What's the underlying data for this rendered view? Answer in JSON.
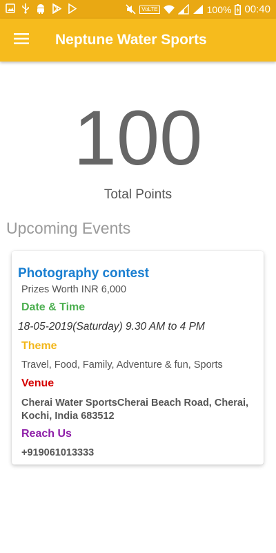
{
  "status_bar": {
    "battery_percent": "100%",
    "time": "00:40",
    "volte_label": "VoLTE",
    "icons_left": [
      "image-icon",
      "usb-icon",
      "android-icon",
      "play-store-icon",
      "play-icon"
    ],
    "icons_right": [
      "mute-icon",
      "volte-icon",
      "wifi-icon",
      "signal-icon",
      "signal-icon",
      "battery-icon"
    ]
  },
  "app_bar": {
    "title": "Neptune Water Sports",
    "menu_icon": "hamburger-menu-icon",
    "background": "#f6bb1d"
  },
  "points": {
    "value": "100",
    "label": "Total Points"
  },
  "upcoming": {
    "title": "Upcoming Events"
  },
  "event": {
    "title": "Photography contest",
    "prize": "Prizes Worth INR 6,000",
    "date_heading": "Date & Time",
    "date_value": "18-05-2019(Saturday) 9.30 AM to 4 PM",
    "theme_heading": "Theme",
    "theme_value": "Travel, Food, Family, Adventure & fun, Sports",
    "venue_heading": "Venue",
    "venue_value": "Cherai Water SportsCherai Beach Road, Cherai, Kochi, India 683512",
    "reach_heading": "Reach Us",
    "phone": "+919061013333"
  },
  "colors": {
    "status_bar": "#e9a813",
    "app_bar": "#f6bb1d",
    "event_title": "#1a7fd1",
    "date_heading": "#4caf50",
    "theme_heading": "#f2b619",
    "venue_heading": "#d50000",
    "reach_heading": "#8e1ea8"
  }
}
